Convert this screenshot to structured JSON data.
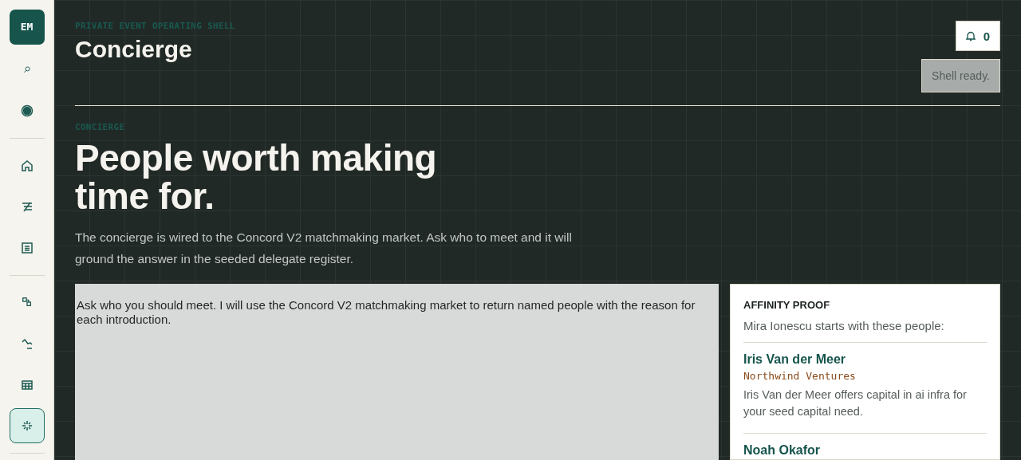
{
  "sidebar": {
    "avatar": "EM",
    "groups": [
      {
        "items": [
          {
            "selected": false
          },
          {
            "selected": false
          }
        ]
      },
      {
        "items": [
          {
            "selected": false
          },
          {
            "selected": false
          },
          {
            "selected": false
          }
        ]
      },
      {
        "items": [
          {
            "selected": false
          },
          {
            "selected": false
          },
          {
            "selected": false
          },
          {
            "selected": true
          }
        ]
      }
    ]
  },
  "header": {
    "eyebrow": "PRIVATE EVENT OPERATING SHELL",
    "title": "Concierge",
    "notifications": "0",
    "status": "Shell ready."
  },
  "hero": {
    "eyebrow": "CONCIERGE",
    "title": "People worth making time for.",
    "lede": "The concierge is wired to the Concord V2 matchmaking market. Ask who to meet and it will ground the answer in the seeded delegate register."
  },
  "chat": {
    "message": "Ask who you should meet. I will use the Concord V2 matchmaking market to return named people with the reason for each introduction."
  },
  "proof": {
    "title": "AFFINITY PROOF",
    "intro": "Mira Ionescu starts with these people:",
    "people": [
      {
        "name": "Iris Van der Meer",
        "company": "Northwind Ventures",
        "reason": "Iris Van der Meer offers capital in ai infra for your seed capital need."
      },
      {
        "name": "Noah Okafor"
      }
    ]
  }
}
